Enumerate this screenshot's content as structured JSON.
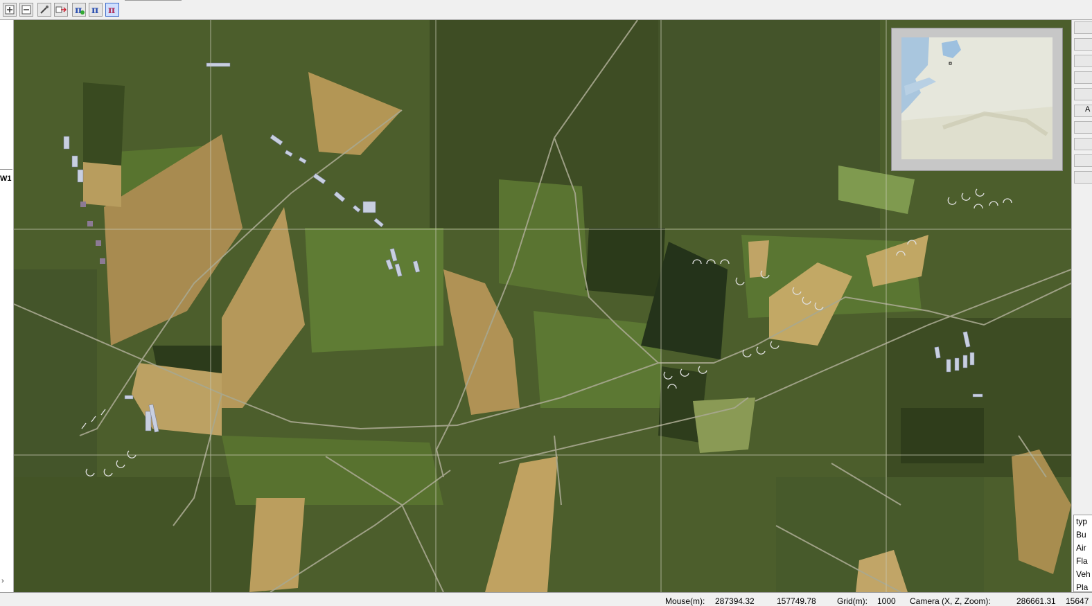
{
  "toolbar": {
    "buttons": [
      {
        "name": "zoom-in",
        "icon": "plus-icon"
      },
      {
        "name": "zoom-out",
        "icon": "minus-icon"
      },
      {
        "name": "picker",
        "icon": "eyedropper-icon"
      },
      {
        "name": "export",
        "icon": "arrow-right-icon"
      },
      {
        "name": "pi-tool-1",
        "icon": "pi-green-icon",
        "glyph": "π"
      },
      {
        "name": "pi-tool-2",
        "icon": "pi-blue-icon",
        "glyph": "π"
      },
      {
        "name": "pi-tool-3",
        "icon": "pi-red-icon",
        "glyph": "π"
      }
    ]
  },
  "left_panel": {
    "tag": "W1",
    "scroll_arrow": "›"
  },
  "right_panel": {
    "button_label": "A",
    "list": [
      "typ",
      "Bu",
      "Air",
      "Fla",
      "Veh",
      "Pla"
    ]
  },
  "status": {
    "mouse_label": "Mouse(m):",
    "mouse_x": "287394.32",
    "mouse_z": "157749.78",
    "grid_label": "Grid(m):",
    "grid_value": "1000",
    "camera_label": "Camera (X, Z, Zoom):",
    "camera_x": "286661.31",
    "camera_z": "15647"
  },
  "colors": {
    "forest": "#3f4f22",
    "grass": "#5e7a33",
    "field_tan": "#b89a58",
    "road": "#a8a890",
    "grid": "#c9c9b4",
    "minimap_water": "#a9c6de",
    "minimap_land": "#e6e7dc"
  }
}
